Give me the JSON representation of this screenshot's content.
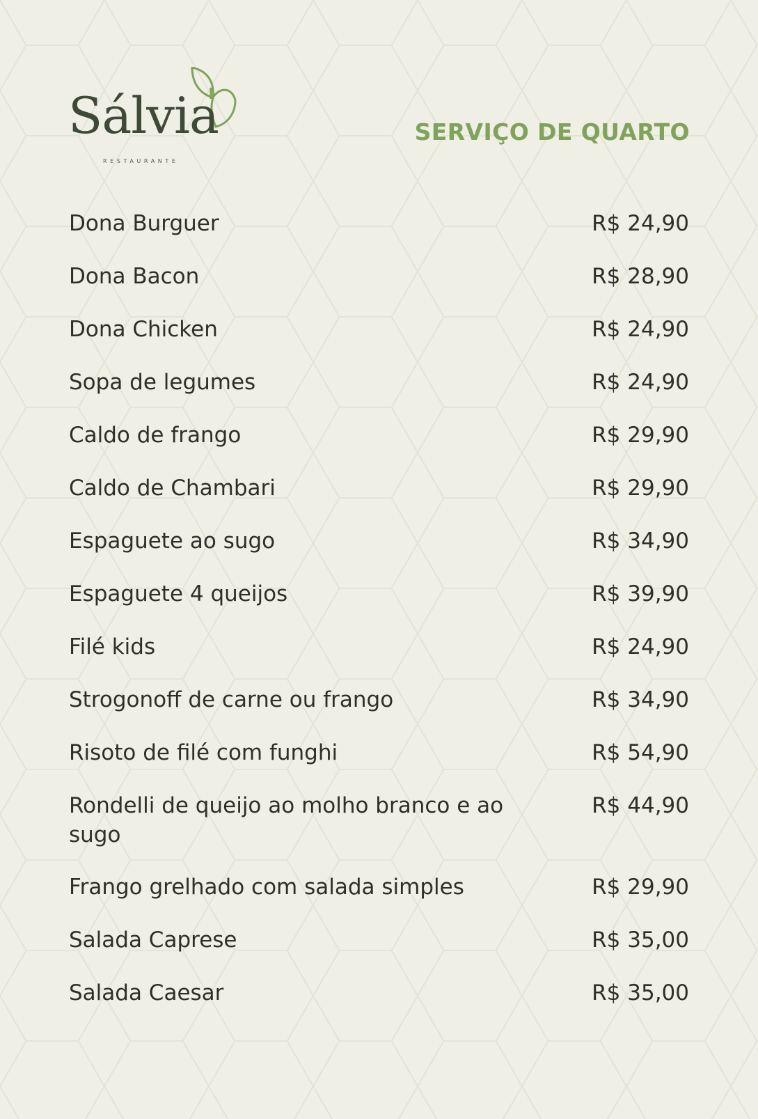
{
  "brand": {
    "name": "Sálvia",
    "tagline": "RESTAURANTE"
  },
  "section_title": "SERVIÇO DE QUARTO",
  "menu_items": [
    {
      "name": "Dona Burguer",
      "price": "R$ 24,90"
    },
    {
      "name": "Dona Bacon",
      "price": "R$ 28,90"
    },
    {
      "name": "Dona Chicken",
      "price": "R$ 24,90"
    },
    {
      "name": "Sopa de legumes",
      "price": "R$ 24,90"
    },
    {
      "name": "Caldo de frango",
      "price": "R$ 29,90"
    },
    {
      "name": "Caldo de Chambari",
      "price": "R$ 29,90"
    },
    {
      "name": "Espaguete ao sugo",
      "price": "R$ 34,90"
    },
    {
      "name": "Espaguete 4 queijos",
      "price": "R$ 39,90"
    },
    {
      "name": "Filé kids",
      "price": "R$ 24,90"
    },
    {
      "name": "Strogonoff de carne ou frango",
      "price": "R$ 34,90"
    },
    {
      "name": "Risoto de filé com funghi",
      "price": "R$ 54,90"
    },
    {
      "name": "Rondelli de queijo ao molho branco e ao sugo",
      "price": "R$ 44,90"
    },
    {
      "name": "Frango grelhado com salada simples",
      "price": "R$ 29,90"
    },
    {
      "name": "Salada Caprese",
      "price": "R$ 35,00"
    },
    {
      "name": "Salada Caesar",
      "price": "R$ 35,00"
    }
  ],
  "colors": {
    "background": "#efefe6",
    "accent": "#7fa35b",
    "brand": "#3f4a36",
    "text": "#2f2f2a"
  }
}
